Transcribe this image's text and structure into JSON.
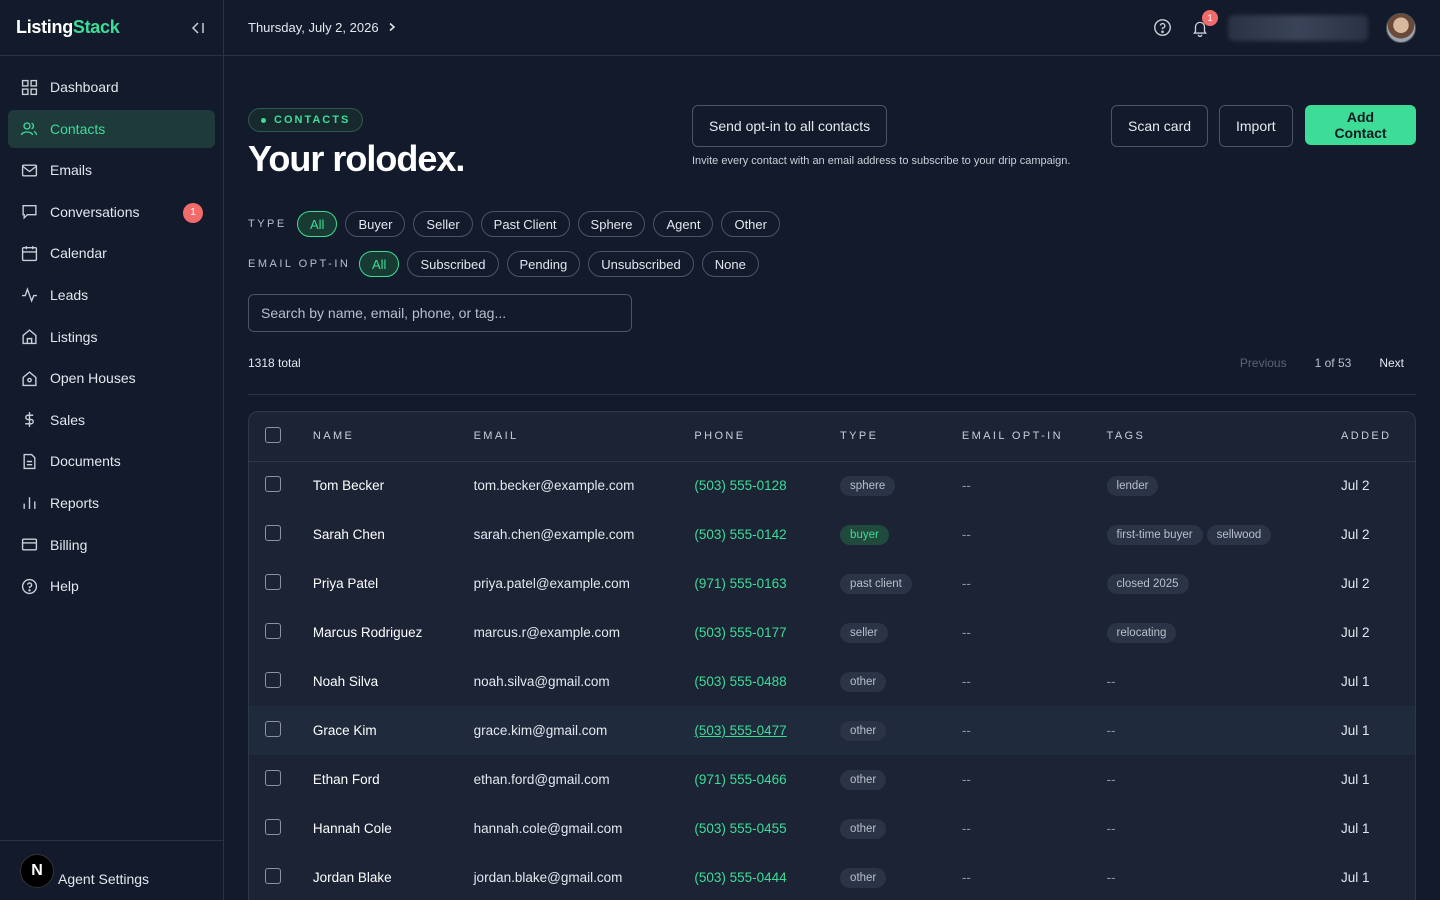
{
  "brand": {
    "part1": "Listing",
    "part2": "Stack"
  },
  "sidebar": {
    "items": [
      {
        "label": "Dashboard"
      },
      {
        "label": "Contacts"
      },
      {
        "label": "Emails"
      },
      {
        "label": "Conversations",
        "badge": "1"
      },
      {
        "label": "Calendar"
      },
      {
        "label": "Leads"
      },
      {
        "label": "Listings"
      },
      {
        "label": "Open Houses"
      },
      {
        "label": "Sales"
      },
      {
        "label": "Documents"
      },
      {
        "label": "Reports"
      },
      {
        "label": "Billing"
      },
      {
        "label": "Help"
      }
    ],
    "footer": {
      "avatar_letter": "N",
      "label": "Agent Settings"
    }
  },
  "topbar": {
    "date": "Thursday, July 2, 2026",
    "notification_count": "1"
  },
  "page": {
    "section_tag": "CONTACTS",
    "title": "Your rolodex.",
    "optin_button": "Send opt-in to all contacts",
    "optin_note": "Invite every contact with an email address to subscribe to your drip campaign.",
    "scan_button": "Scan card",
    "import_button": "Import",
    "add_button": "Add Contact"
  },
  "filters": {
    "type_label": "TYPE",
    "type_options": [
      "All",
      "Buyer",
      "Seller",
      "Past Client",
      "Sphere",
      "Agent",
      "Other"
    ],
    "type_selected": "All",
    "optin_label": "EMAIL OPT-IN",
    "optin_options": [
      "All",
      "Subscribed",
      "Pending",
      "Unsubscribed",
      "None"
    ],
    "optin_selected": "All"
  },
  "search": {
    "placeholder": "Search by name, email, phone, or tag..."
  },
  "summary": {
    "total": "1318 total",
    "previous": "Previous",
    "position": "1 of 53",
    "next": "Next"
  },
  "table": {
    "columns": [
      "NAME",
      "EMAIL",
      "PHONE",
      "TYPE",
      "EMAIL OPT-IN",
      "TAGS",
      "ADDED"
    ],
    "rows": [
      {
        "name": "Tom Becker",
        "email": "tom.becker@example.com",
        "phone": "(503) 555-0128",
        "type": "sphere",
        "optin": "--",
        "tags": [
          "lender"
        ],
        "added": "Jul 2"
      },
      {
        "name": "Sarah Chen",
        "email": "sarah.chen@example.com",
        "phone": "(503) 555-0142",
        "type": "buyer",
        "optin": "--",
        "tags": [
          "first-time buyer",
          "sellwood"
        ],
        "added": "Jul 2"
      },
      {
        "name": "Priya Patel",
        "email": "priya.patel@example.com",
        "phone": "(971) 555-0163",
        "type": "past client",
        "optin": "--",
        "tags": [
          "closed 2025"
        ],
        "added": "Jul 2"
      },
      {
        "name": "Marcus Rodriguez",
        "email": "marcus.r@example.com",
        "phone": "(503) 555-0177",
        "type": "seller",
        "optin": "--",
        "tags": [
          "relocating"
        ],
        "added": "Jul 2"
      },
      {
        "name": "Noah Silva",
        "email": "noah.silva@gmail.com",
        "phone": "(503) 555-0488",
        "type": "other",
        "optin": "--",
        "tags": [],
        "tags_empty": "--",
        "added": "Jul 1"
      },
      {
        "name": "Grace Kim",
        "email": "grace.kim@gmail.com",
        "phone": "(503) 555-0477",
        "type": "other",
        "optin": "--",
        "tags": [],
        "tags_empty": "--",
        "added": "Jul 1",
        "hover": true
      },
      {
        "name": "Ethan Ford",
        "email": "ethan.ford@gmail.com",
        "phone": "(971) 555-0466",
        "type": "other",
        "optin": "--",
        "tags": [],
        "tags_empty": "--",
        "added": "Jul 1"
      },
      {
        "name": "Hannah Cole",
        "email": "hannah.cole@gmail.com",
        "phone": "(503) 555-0455",
        "type": "other",
        "optin": "--",
        "tags": [],
        "tags_empty": "--",
        "added": "Jul 1"
      },
      {
        "name": "Jordan Blake",
        "email": "jordan.blake@gmail.com",
        "phone": "(503) 555-0444",
        "type": "other",
        "optin": "--",
        "tags": [],
        "tags_empty": "--",
        "added": "Jul 1"
      }
    ]
  },
  "colors": {
    "accent": "#3ddc97",
    "background": "#131a2b",
    "badge": "#f26b6b"
  }
}
